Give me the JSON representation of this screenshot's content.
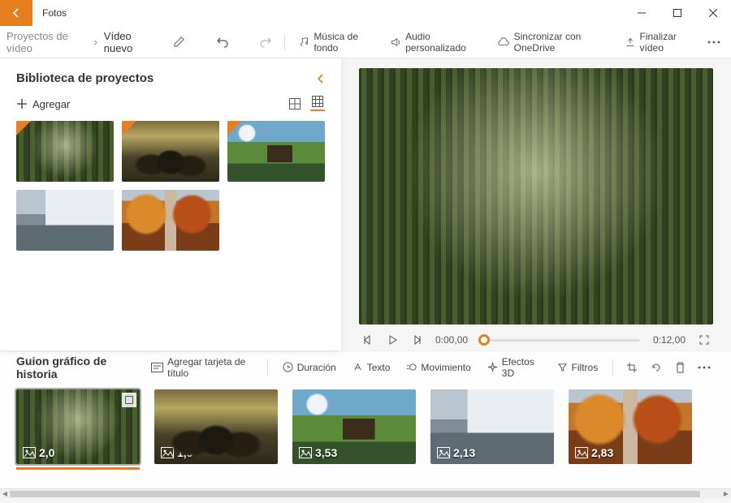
{
  "app": {
    "title": "Fotos"
  },
  "breadcrumb": {
    "root": "Proyectos de vídeo",
    "current": "Vídeo nuevo"
  },
  "toolbar": {
    "bgmusic": "Música de fondo",
    "custaudio": "Audio personalizado",
    "sync": "Sincronizar con OneDrive",
    "finish": "Finalizar vídeo"
  },
  "library": {
    "title": "Biblioteca de proyectos",
    "add": "Agregar",
    "thumbs": [
      {
        "scene": "forest",
        "marked": true
      },
      {
        "scene": "rocks",
        "marked": true
      },
      {
        "scene": "cabin",
        "marked": true
      },
      {
        "scene": "mountain",
        "marked": false
      },
      {
        "scene": "autumn",
        "marked": false
      }
    ]
  },
  "preview": {
    "current_time": "0:00,00",
    "total_time": "0:12,00"
  },
  "storyboard": {
    "title": "Guion gráfico de historia",
    "add_title_card": "Agregar tarjeta de título",
    "duration": "Duración",
    "text": "Texto",
    "motion": "Movimiento",
    "fx3d": "Efectos 3D",
    "filters": "Filtros",
    "clips": [
      {
        "scene": "forest",
        "duration": "2,0",
        "selected": true
      },
      {
        "scene": "rocks",
        "duration": "1,5",
        "selected": false
      },
      {
        "scene": "cabin",
        "duration": "3,53",
        "selected": false
      },
      {
        "scene": "mountain",
        "duration": "2,13",
        "selected": false
      },
      {
        "scene": "autumn",
        "duration": "2,83",
        "selected": false
      }
    ]
  },
  "colors": {
    "accent": "#e67e22"
  }
}
